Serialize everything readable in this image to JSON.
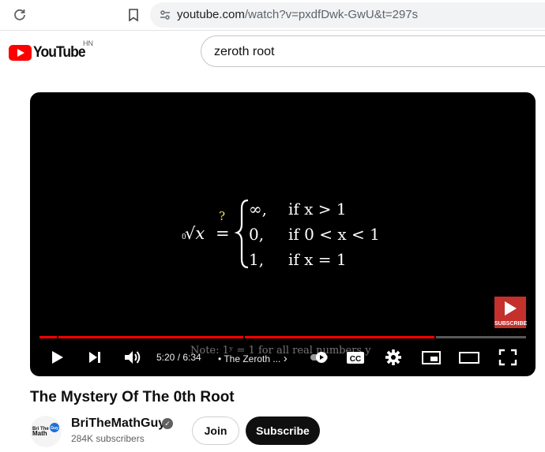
{
  "browser": {
    "url_host": "youtube.com",
    "url_rest": "/watch?v=pxdfDwk-GwU&t=297s",
    "reload_icon": "reload-icon",
    "bookmark_icon": "bookmark-icon"
  },
  "header": {
    "logo_text": "YouTube",
    "country_code": "HN",
    "search_value": "zeroth root"
  },
  "video": {
    "formula": {
      "lhs": "ⁿ√x",
      "root_index": "0",
      "question_mark": "?",
      "cases": [
        {
          "value": "∞,",
          "condition": "if x > 1"
        },
        {
          "value": "0,",
          "condition": "if 0 < x < 1"
        },
        {
          "value": "1,",
          "condition": "if x = 1"
        }
      ]
    },
    "caption_note": "Note: 1ʸ = 1 for all real numbers y",
    "watermark_label": "SUBSCRIBE",
    "time": "5:20 / 6:34",
    "chapter": "• The Zeroth ...",
    "chapter_arrow": "›",
    "cc_label": "CC",
    "progress_fraction": 0.8125
  },
  "details": {
    "title": "The Mystery Of The 0th Root",
    "channel_name": "BriTheMathGuy",
    "verified_icon": "verified-check-icon",
    "subscribers": "284K subscribers",
    "join_label": "Join",
    "subscribe_label": "Subscribe",
    "avatar_text": "BriTheMath"
  },
  "colors": {
    "accent_red": "#ff0000",
    "math_yellow": "#f2e84b"
  }
}
